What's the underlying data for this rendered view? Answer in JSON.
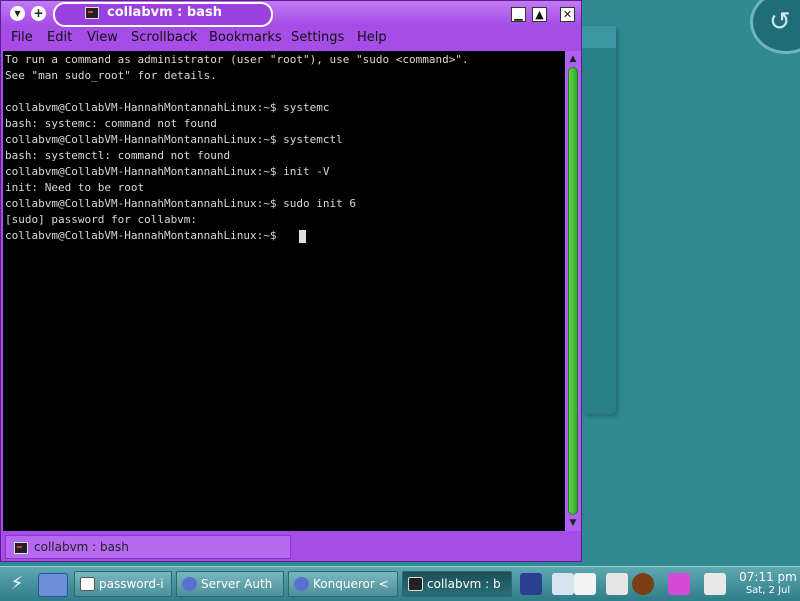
{
  "window": {
    "title": "collabvm : bash",
    "menu": [
      "File",
      "Edit",
      "View",
      "Scrollback",
      "Bookmarks",
      "Settings",
      "Help"
    ]
  },
  "terminal": {
    "lines": [
      "To run a command as administrator (user \"root\"), use \"sudo <command>\".",
      "See \"man sudo_root\" for details.",
      "",
      "collabvm@CollabVM-HannahMontannahLinux:~$ systemc",
      "bash: systemc: command not found",
      "collabvm@CollabVM-HannahMontannahLinux:~$ systemctl",
      "bash: systemctl: command not found",
      "collabvm@CollabVM-HannahMontannahLinux:~$ init -V",
      "init: Need to be root",
      "collabvm@CollabVM-HannahMontannahLinux:~$ sudo init 6",
      "[sudo] password for collabvm:",
      "collabvm@CollabVM-HannahMontannahLinux:~$ "
    ]
  },
  "tab": {
    "label": "collabvm : bash"
  },
  "taskbar": {
    "tasks": [
      {
        "label": "password-i",
        "icon": "document-icon"
      },
      {
        "label": "Server Auth",
        "icon": "gear-icon"
      },
      {
        "label": "Konqueror <",
        "icon": "gear-icon"
      },
      {
        "label": "collabvm : b",
        "icon": "terminal-icon"
      }
    ],
    "clock": {
      "time": "07:11 pm",
      "date": "Sat, 2 Jul"
    }
  },
  "colors": {
    "window_accent": "#a64de8",
    "scroll_thumb": "#3fbf35",
    "desktop": "#2f8a92"
  }
}
